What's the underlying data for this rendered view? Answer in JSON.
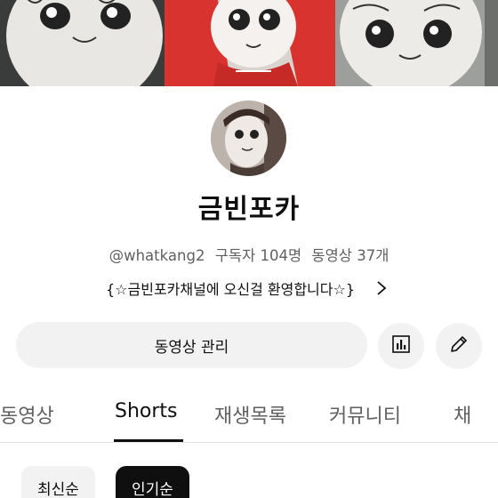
{
  "channel": {
    "name": "금빈포카",
    "handle": "@whatkang2",
    "subscribers": "구독자 104명",
    "videos": "동영상 37개",
    "description": "{☆금빈포카채널에 오신걸 환영합니다☆}"
  },
  "actions": {
    "manage_label": "동영상 관리"
  },
  "tabs": [
    {
      "label": "동영상"
    },
    {
      "label": "Shorts"
    },
    {
      "label": "재생목록"
    },
    {
      "label": "커뮤니티"
    },
    {
      "label": "채"
    }
  ],
  "chips": [
    {
      "label": "최신순"
    },
    {
      "label": "인기순"
    }
  ],
  "colors": {
    "chip_selected": "#0f0f0f",
    "button_bg": "#f2f2f2",
    "text_secondary": "#606060"
  },
  "icons": {
    "description_more": "chevron-right-icon",
    "stats": "bar-chart-icon",
    "edit": "pencil-icon"
  }
}
